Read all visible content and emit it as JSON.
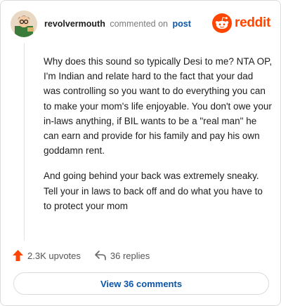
{
  "comment": {
    "username": "revolvermouth",
    "action_text": "commented on",
    "link_text": "post",
    "paragraphs": [
      "Why does this sound so typically Desi to me? NTA OP, I'm Indian and relate hard to the fact that your dad was controlling so you want to do everything you can to make your mom's life enjoyable. You don't owe your in-laws anything, if BIL wants to be a \"real man\" he can earn and provide for his family and pay his own goddamn rent.",
      "And going behind your back was extremely sneaky. Tell your in laws to back off and do what you have to to protect your mom"
    ]
  },
  "brand": {
    "name": "reddit",
    "icon": "reddit-logo-icon",
    "color": "#ff4500"
  },
  "stats": {
    "upvotes_label": "2.3K upvotes",
    "replies_label": "36 replies",
    "upvote_icon": "upvote-arrow-icon",
    "reply_icon": "reply-arrow-icon",
    "upvote_color": "#ff4500"
  },
  "footer": {
    "view_comments_label": "View 36 comments"
  }
}
